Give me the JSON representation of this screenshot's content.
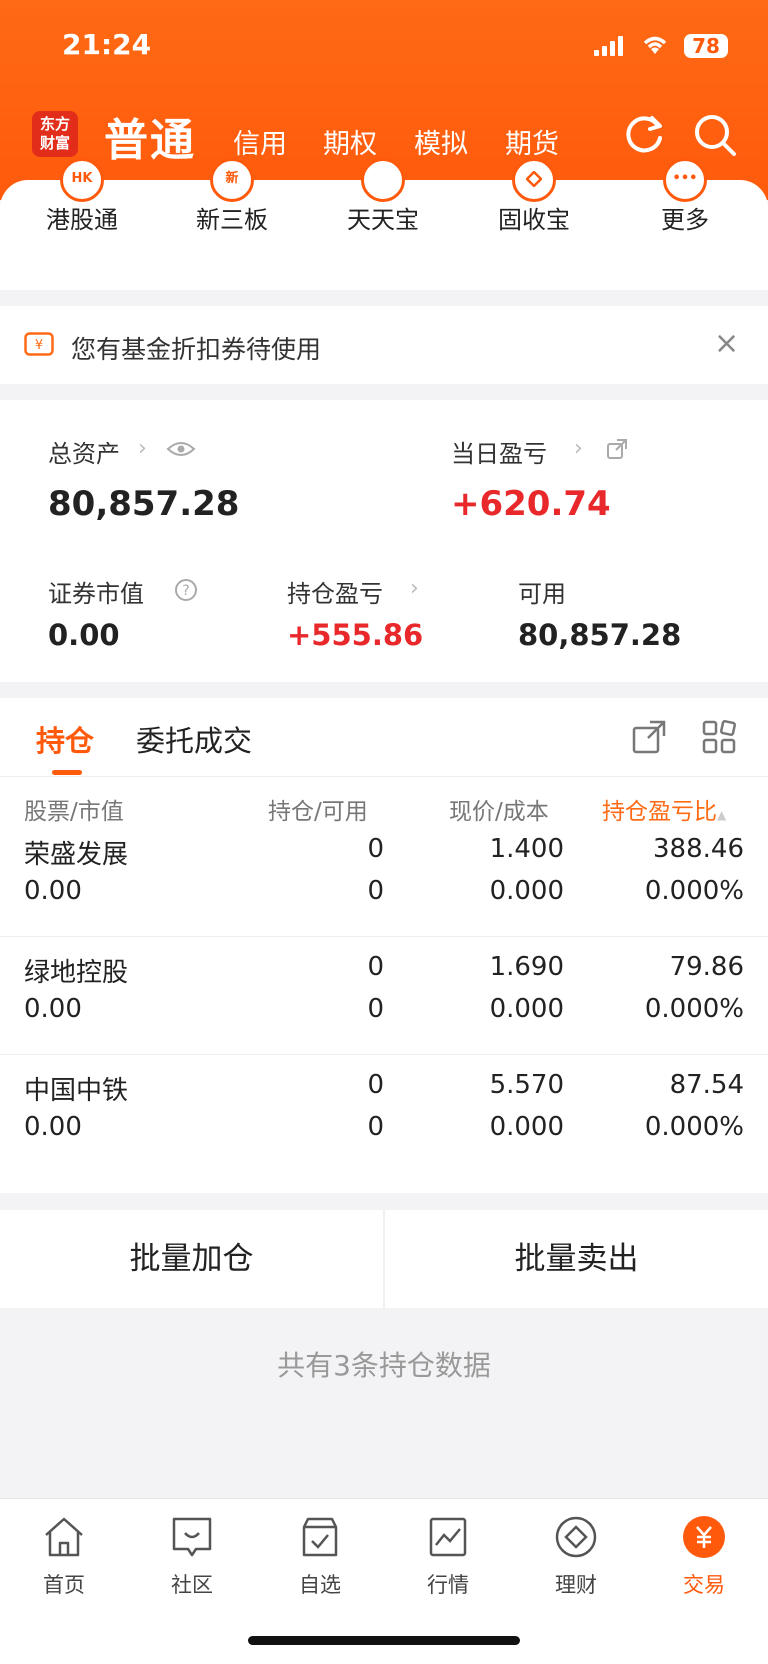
{
  "status_bar": {
    "time": "21:24",
    "battery": "78"
  },
  "header": {
    "logo_line1": "东方",
    "logo_line2": "财富",
    "title": "普通",
    "tabs": [
      "信用",
      "期权",
      "模拟",
      "期货"
    ]
  },
  "quick_nav": [
    {
      "label": "港股通",
      "icon": "HK"
    },
    {
      "label": "新三板",
      "icon": "新"
    },
    {
      "label": "天天宝",
      "icon": ""
    },
    {
      "label": "固收宝",
      "icon": ""
    },
    {
      "label": "更多",
      "icon": "•••"
    }
  ],
  "coupon": {
    "text": "您有基金折扣券待使用",
    "close": "×"
  },
  "assets": {
    "total_label": "总资产",
    "total_value": "80,857.28",
    "daily_label": "当日盈亏",
    "daily_value": "+620.74",
    "market_label": "证券市值",
    "market_value": "0.00",
    "holding_label": "持仓盈亏",
    "holding_value": "+555.86",
    "available_label": "可用",
    "available_value": "80,857.28"
  },
  "positions": {
    "tab_hold": "持仓",
    "tab_orders": "委托成交",
    "headers": {
      "stock": "股票",
      "stock_sub": "/市值",
      "qty": "持仓",
      "qty_sub": "/可用",
      "price": "现价",
      "price_sub": "/成本",
      "pl": "持仓盈亏比"
    },
    "rows": [
      {
        "name": "荣盛发展",
        "market": "0.00",
        "hold": "0",
        "avail": "0",
        "price": "1.400",
        "cost": "0.000",
        "pl": "388.46",
        "pct": "0.000%"
      },
      {
        "name": "绿地控股",
        "market": "0.00",
        "hold": "0",
        "avail": "0",
        "price": "1.690",
        "cost": "0.000",
        "pl": "79.86",
        "pct": "0.000%"
      },
      {
        "name": "中国中铁",
        "market": "0.00",
        "hold": "0",
        "avail": "0",
        "price": "5.570",
        "cost": "0.000",
        "pl": "87.54",
        "pct": "0.000%"
      }
    ]
  },
  "actions": {
    "add": "批量加仓",
    "sell": "批量卖出"
  },
  "summary": "共有3条持仓数据",
  "bottom_nav": [
    {
      "label": "首页",
      "icon": "home-icon"
    },
    {
      "label": "社区",
      "icon": "chat-icon"
    },
    {
      "label": "自选",
      "icon": "watchlist-icon"
    },
    {
      "label": "行情",
      "icon": "chart-icon"
    },
    {
      "label": "理财",
      "icon": "diamond-icon"
    },
    {
      "label": "交易",
      "icon": "yuan-icon",
      "active": true
    }
  ],
  "colors": {
    "brand": "#ff5a0c",
    "gain": "#e8282b"
  }
}
